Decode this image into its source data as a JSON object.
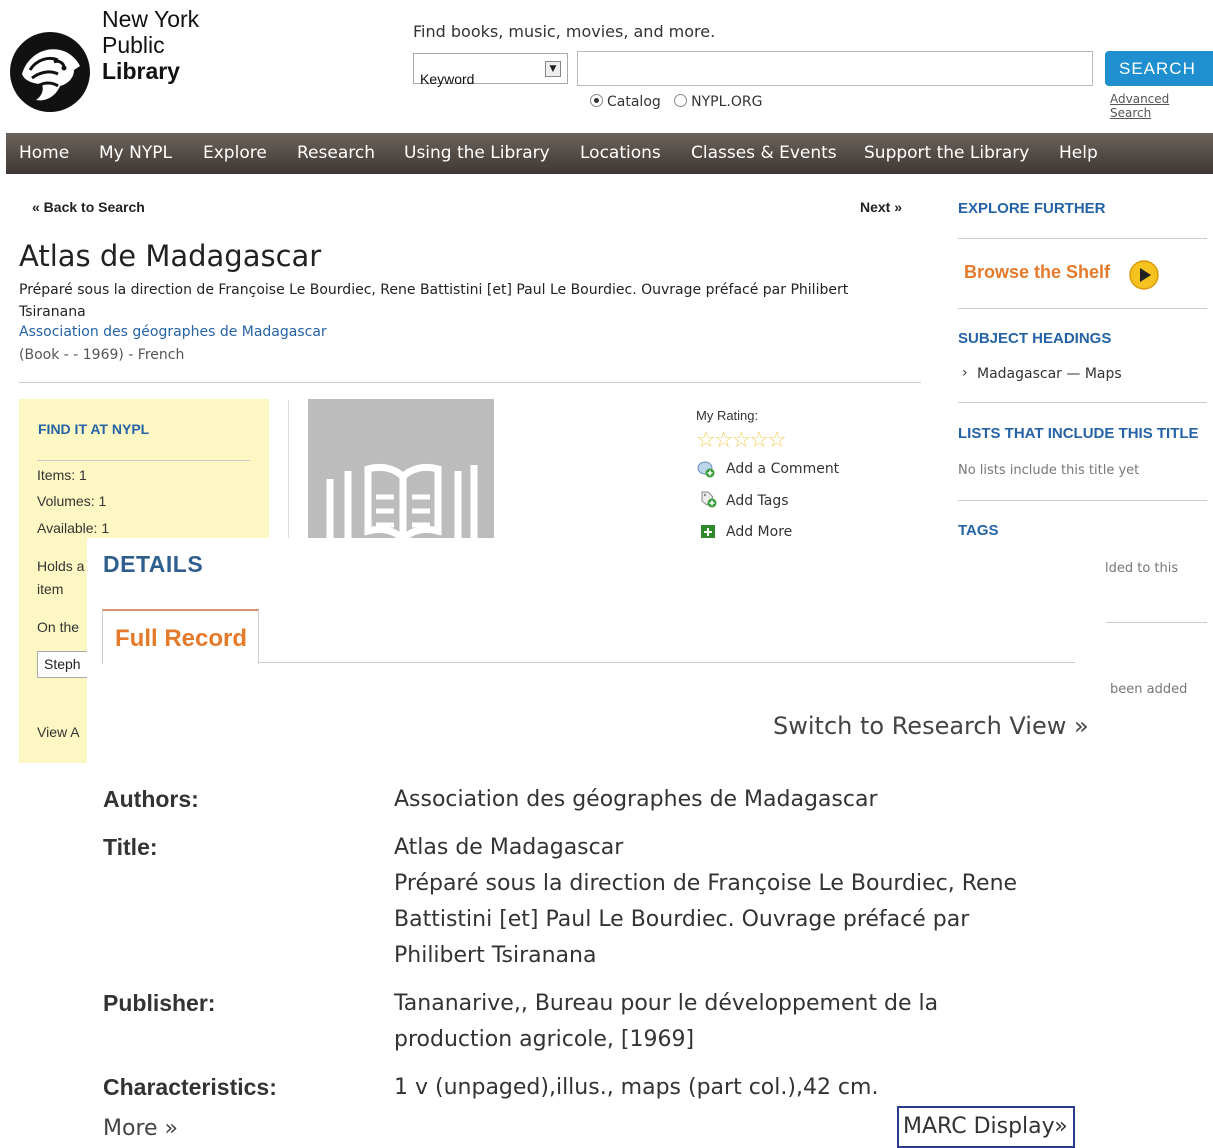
{
  "header": {
    "logo_lines": [
      "New York",
      "Public",
      "Library"
    ],
    "find_label": "Find books, music, movies, and more.",
    "search_type": "Keyword",
    "search_value": "",
    "search_button": "SEARCH",
    "advanced_search": "Advanced Search",
    "radio_catalog": "Catalog",
    "radio_nypl": "NYPL.ORG",
    "radio_selected": "Catalog"
  },
  "nav": {
    "items": [
      "Home",
      "My NYPL",
      "Explore",
      "Research",
      "Using the Library",
      "Locations",
      "Classes & Events",
      "Support the Library",
      "Help"
    ]
  },
  "record": {
    "back": "« Back to Search",
    "next": "Next »",
    "title": "Atlas de Madagascar",
    "subtitle": "Préparé sous la direction de Françoise Le Bourdiec, Rene Battistini [et] Paul Le Bourdiec. Ouvrage préfacé par Philibert Tsiranana",
    "author": "Association des géographes de Madagascar",
    "meta": "(Book - - 1969) - French"
  },
  "find_panel": {
    "title": "FIND IT AT NYPL",
    "items": "Items: 1",
    "volumes": "Volumes: 1",
    "available": "Available: 1",
    "holds_1": "Holds a",
    "holds_2": "item",
    "on_the": "On the",
    "location": "Steph",
    "view": "View A"
  },
  "actions": {
    "my_rating": "My Rating:",
    "rating_stars": 0,
    "add_comment": "Add a Comment",
    "add_tags": "Add Tags",
    "add_more": "Add More"
  },
  "sidebar": {
    "explore_further": "EXPLORE FURTHER",
    "browse_shelf": "Browse the Shelf",
    "subject_headings": "SUBJECT HEADINGS",
    "subject": "Madagascar — Maps",
    "lists_heading": "LISTS THAT INCLUDE THIS TITLE",
    "lists_empty": "No lists include this title yet",
    "tags_heading": "TAGS",
    "tags_partial": "lded to this",
    "been_added": "been added"
  },
  "details": {
    "heading": "DETAILS",
    "tab": "Full Record",
    "switch_view": "Switch to Research View »",
    "fields": {
      "authors_label": "Authors:",
      "authors_value": "Association des géographes de Madagascar",
      "title_label": "Title:",
      "title_value_1": "Atlas de Madagascar",
      "title_value_2": "Préparé sous la direction de Françoise Le Bourdiec, Rene",
      "title_value_3": "Battistini [et] Paul Le Bourdiec. Ouvrage préfacé par",
      "title_value_4": "Philibert Tsiranana",
      "publisher_label": "Publisher:",
      "publisher_value_1": "Tananarive,, Bureau pour le développement de la",
      "publisher_value_2": "production agricole, [1969]",
      "characteristics_label": "Characteristics:",
      "characteristics_value": "1 v (unpaged),illus., maps (part col.),42 cm."
    },
    "more": "More »",
    "marc_display": "MARC Display»"
  }
}
